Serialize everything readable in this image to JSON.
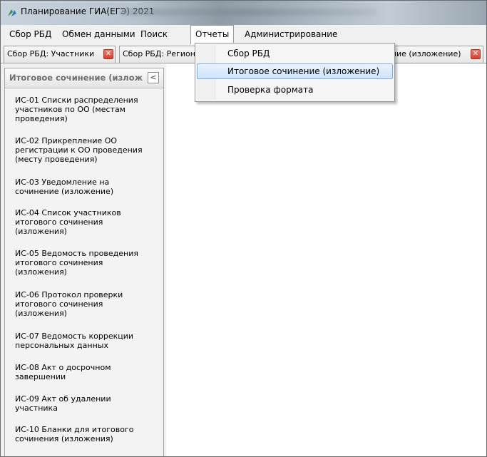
{
  "window": {
    "title": "Планирование ГИА(ЕГЭ) 2021"
  },
  "menu": {
    "items": [
      {
        "label": "Сбор РБД"
      },
      {
        "label": "Обмен данными"
      },
      {
        "label": "Поиск"
      },
      {
        "label": "Отчеты"
      },
      {
        "label": "Администрирование"
      }
    ],
    "open_item": "Отчеты"
  },
  "dropdown": {
    "items": [
      {
        "label": "Сбор РБД"
      },
      {
        "label": "Итоговое сочинение (изложение)"
      },
      {
        "label": "Проверка формата"
      }
    ],
    "highlighted": "Итоговое сочинение (изложение)"
  },
  "tabs": [
    {
      "label": "Сбор РБД: Участники"
    },
    {
      "label": "Сбор РБД: Регион"
    },
    {
      "label": "ение (изложение)"
    }
  ],
  "left_panel": {
    "title": "Итоговое сочинение (излож",
    "collapse_glyph": "<",
    "reports": [
      {
        "label": "ИС-01 Списки распределения участников по ОО (местам проведения)"
      },
      {
        "label": "ИС-02 Прикрепление ОО регистрации к ОО проведения (месту проведения)"
      },
      {
        "label": "ИС-03 Уведомление на сочинение (изложение)"
      },
      {
        "label": "ИС-04 Список участников итогового сочинения (изложения)"
      },
      {
        "label": "ИС-05 Ведомость проведения итогового сочинения (изложения)"
      },
      {
        "label": "ИС-06 Протокол проверки итогового сочинения (изложения)"
      },
      {
        "label": "ИС-07 Ведомость коррекции персональных данных"
      },
      {
        "label": "ИС-08 Акт о досрочном завершении"
      },
      {
        "label": "ИС-09 Акт об удалении участника"
      },
      {
        "label": "ИС-10 Бланки для итогового сочинения (изложения)"
      }
    ]
  },
  "icons": {
    "app": "app-logo-icon",
    "tab_close": "close-icon",
    "collapse": "chevron-left-icon"
  },
  "colors": {
    "highlight_border": "#7daee6",
    "close_button": "#d2412e",
    "panel_title": "#6e6e6e"
  }
}
